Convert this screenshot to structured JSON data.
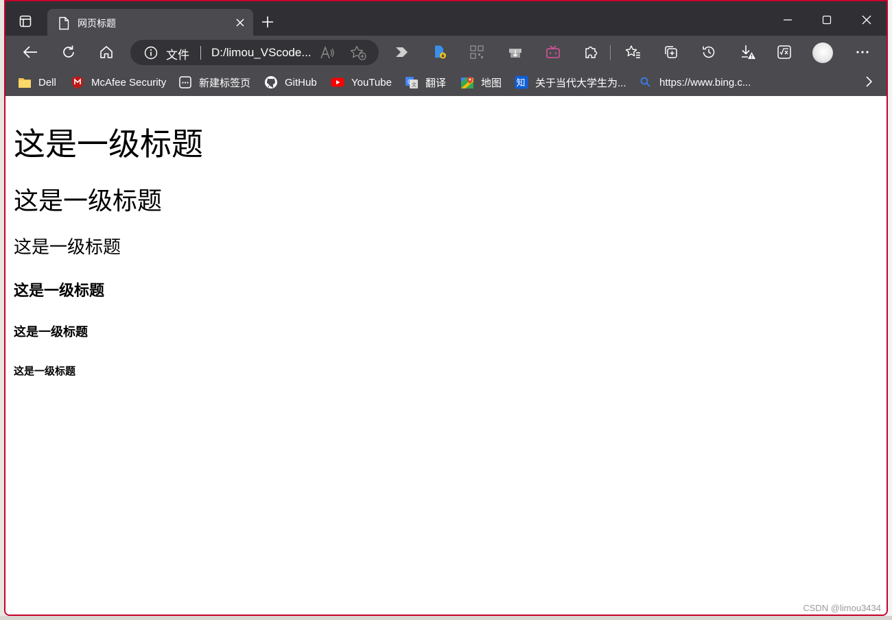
{
  "tab": {
    "title": "网页标题"
  },
  "address_bar": {
    "scheme_label": "文件",
    "url": "D:/limou_VScode..."
  },
  "bookmarks": [
    {
      "label": "Dell",
      "icon": "folder-icon"
    },
    {
      "label": "McAfee Security",
      "icon": "mcafee-icon"
    },
    {
      "label": "新建标签页",
      "icon": "newtab-page-icon"
    },
    {
      "label": "GitHub",
      "icon": "github-icon"
    },
    {
      "label": "YouTube",
      "icon": "youtube-icon"
    },
    {
      "label": "翻译",
      "icon": "translate-icon"
    },
    {
      "label": "地图",
      "icon": "maps-icon"
    },
    {
      "label": "关于当代大学生为...",
      "icon": "zhihu-icon"
    },
    {
      "label": "https://www.bing.c...",
      "icon": "bing-search-icon"
    }
  ],
  "page": {
    "h1": "这是一级标题",
    "h2": "这是一级标题",
    "h3": "这是一级标题",
    "h4": "这是一级标题",
    "h5": "这是一级标题",
    "h6": "这是一级标题"
  },
  "watermark": "CSDN @limou3434",
  "colors": {
    "window_border": "#c5002c",
    "titlebar": "#303034",
    "toolbar": "#4a4a4f",
    "youtube_red": "#ff0000"
  }
}
